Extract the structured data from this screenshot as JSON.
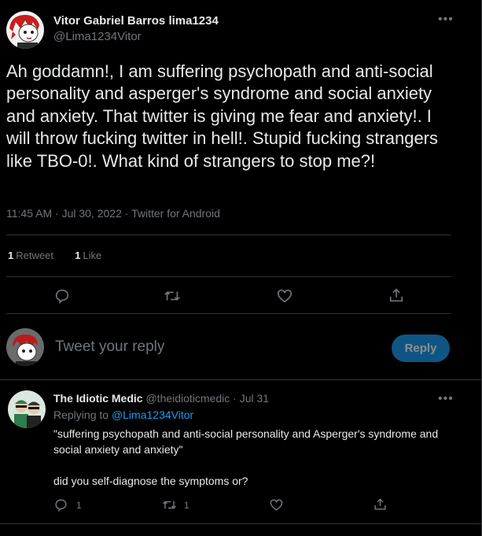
{
  "tweet": {
    "display_name": "Vitor Gabriel Barros lima1234",
    "handle": "@Lima1234Vitor",
    "text": "Ah goddamn!, I am suffering psychopath and anti-social personality and asperger's syndrome and social anxiety and anxiety. That twitter is giving me fear and anxiety!. I will throw fucking twitter in hell!. Stupid fucking strangers like TBO-0!. What kind of strangers to stop me?!",
    "time": "11:45 AM",
    "date": "Jul 30, 2022",
    "source": "Twitter for Android",
    "retweet_count": "1",
    "retweet_label": "Retweet",
    "like_count": "1",
    "like_label": "Like"
  },
  "reply_box": {
    "placeholder": "Tweet your reply",
    "button_label": "Reply"
  },
  "reply": {
    "display_name": "The Idiotic Medic",
    "handle": "@theidioticmedic",
    "date": "Jul 31",
    "replying_prefix": "Replying to",
    "replying_to": "@Lima1234Vitor",
    "text": "\"suffering psychopath and anti-social personality and Asperger's syndrome and social anxiety and anxiety\"\n\ndid you self-diagnose the symptoms or?",
    "reply_count": "1",
    "retweet_count": "1"
  },
  "icons": {
    "more": "more-icon",
    "reply": "reply-icon",
    "retweet": "retweet-icon",
    "like": "heart-icon",
    "share": "share-icon"
  },
  "colors": {
    "background": "#000000",
    "text": "#e7e9ea",
    "muted": "#71767b",
    "accent": "#1d9bf0",
    "divider": "#2f3336"
  }
}
